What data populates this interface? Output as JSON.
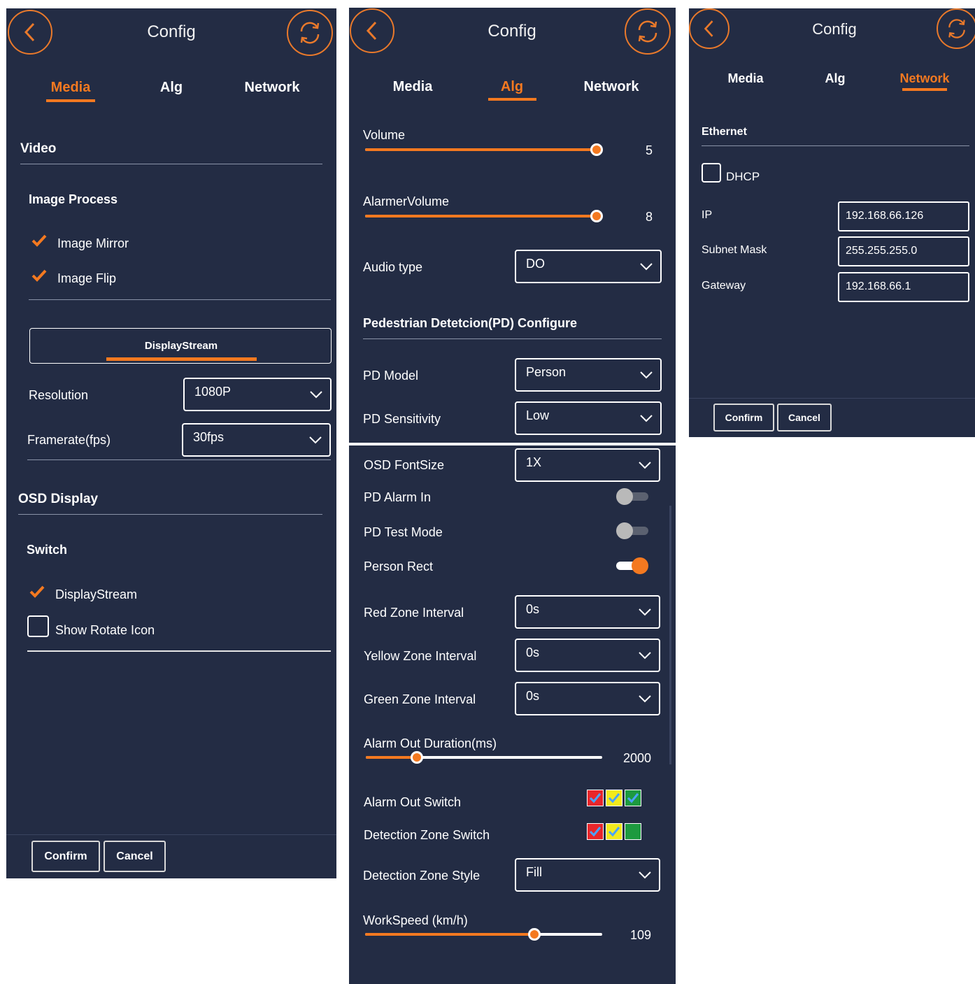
{
  "header": {
    "title": "Config"
  },
  "tabs": {
    "media": "Media",
    "alg": "Alg",
    "network": "Network"
  },
  "media": {
    "video_title": "Video",
    "image_process_title": "Image Process",
    "image_mirror": {
      "label": "Image Mirror",
      "checked": true
    },
    "image_flip": {
      "label": "Image Flip",
      "checked": true
    },
    "stream_tab": "DisplayStream",
    "resolution": {
      "label": "Resolution",
      "value": "1080P"
    },
    "framerate": {
      "label": "Framerate(fps)",
      "value": "30fps"
    },
    "osd_title": "OSD Display",
    "switch_title": "Switch",
    "display_stream": {
      "label": "DisplayStream",
      "checked": true
    },
    "show_rotate_icon": {
      "label": "Show Rotate Icon",
      "checked": false
    }
  },
  "buttons": {
    "confirm": "Confirm",
    "cancel": "Cancel"
  },
  "alg": {
    "volume": {
      "label": "Volume",
      "value": "5",
      "level": 1.0
    },
    "alarmer_volume": {
      "label": "AlarmerVolume",
      "value": "8",
      "level": 1.0
    },
    "audio_type": {
      "label": "Audio type",
      "value": "DO"
    },
    "pd_title": "Pedestrian Detetcion(PD) Configure",
    "pd_model": {
      "label": "PD Model",
      "value": "Person"
    },
    "pd_sensitivity": {
      "label": "PD Sensitivity",
      "value": "Low"
    },
    "osd_fontsize": {
      "label": "OSD FontSize",
      "value": "1X"
    },
    "pd_alarm_in": {
      "label": "PD Alarm In",
      "on": false
    },
    "pd_test_mode": {
      "label": "PD Test Mode",
      "on": false
    },
    "person_rect": {
      "label": "Person Rect",
      "on": true
    },
    "red_zone": {
      "label": "Red Zone Interval",
      "value": "0s"
    },
    "yellow_zone": {
      "label": "Yellow Zone Interval",
      "value": "0s"
    },
    "green_zone": {
      "label": "Green Zone Interval",
      "value": "0s"
    },
    "alarm_out_duration": {
      "label": "Alarm Out Duration(ms)",
      "value": "2000",
      "level": 0.2
    },
    "alarm_out_switch": {
      "label": "Alarm Out Switch"
    },
    "detection_zone_switch": {
      "label": "Detection Zone Switch"
    },
    "detection_zone_style": {
      "label": "Detection Zone Style",
      "value": "Fill"
    },
    "work_speed": {
      "label": "WorkSpeed (km/h)",
      "value": "109",
      "level": 0.72
    }
  },
  "network": {
    "ethernet_title": "Ethernet",
    "dhcp": {
      "label": "DHCP",
      "checked": false
    },
    "ip": {
      "label": "IP",
      "value": "192.168.66.126"
    },
    "subnet": {
      "label": "Subnet Mask",
      "value": "255.255.255.0"
    },
    "gateway": {
      "label": "Gateway",
      "value": "192.168.66.1"
    }
  },
  "colors": {
    "accent": "#f47920",
    "panel": "#232c44",
    "red": "#e8262b",
    "yellow": "#f2ea1d",
    "green": "#1d9a3f"
  },
  "icons": {
    "back": "chevron-left-icon",
    "refresh": "refresh-icon",
    "dropdown": "chevron-down-icon",
    "check": "check-icon"
  }
}
